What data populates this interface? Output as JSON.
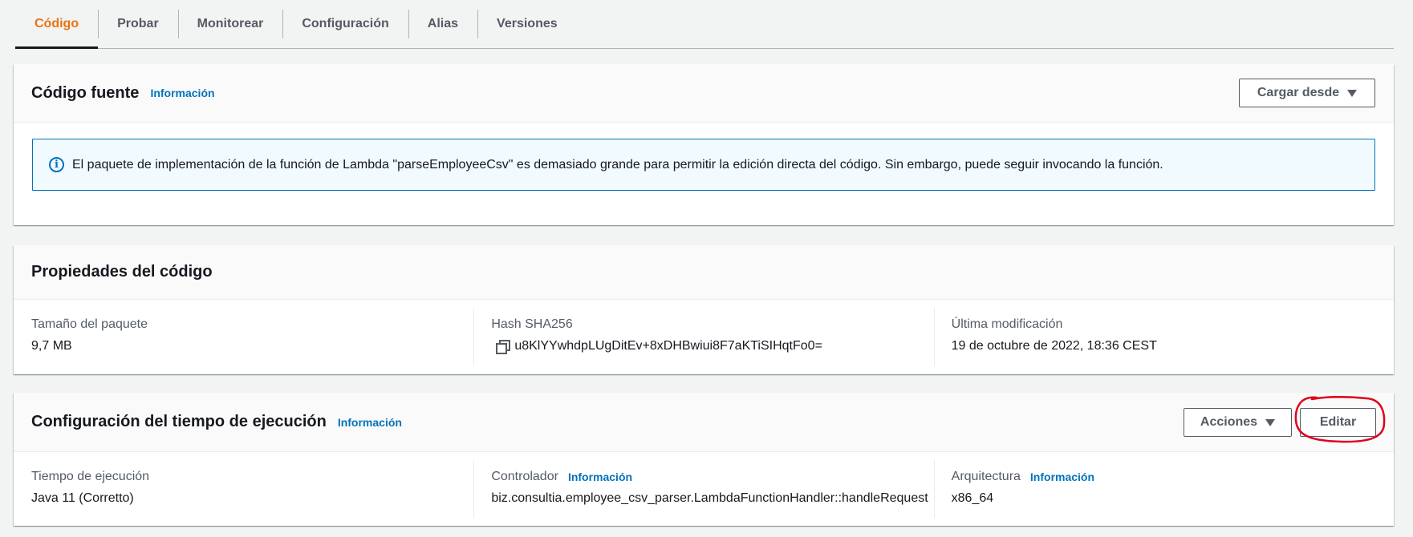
{
  "tabs": [
    "Código",
    "Probar",
    "Monitorear",
    "Configuración",
    "Alias",
    "Versiones"
  ],
  "source_panel": {
    "title": "Código fuente",
    "info": "Información",
    "upload_button": "Cargar desde",
    "alert_text": "El paquete de implementación de la función de Lambda \"parseEmployeeCsv\" es demasiado grande para permitir la edición directa del código. Sin embargo, puede seguir invocando la función."
  },
  "code_properties": {
    "title": "Propiedades del código",
    "package_size_label": "Tamaño del paquete",
    "package_size_value": "9,7 MB",
    "hash_label": "Hash SHA256",
    "hash_value": "u8KlYYwhdpLUgDitEv+8xDHBwiui8F7aKTiSIHqtFo0=",
    "modified_label": "Última modificación",
    "modified_value": "19 de octubre de 2022, 18:36 CEST"
  },
  "runtime_settings": {
    "title": "Configuración del tiempo de ejecución",
    "info": "Información",
    "actions_button": "Acciones",
    "edit_button": "Editar",
    "runtime_label": "Tiempo de ejecución",
    "runtime_value": "Java 11 (Corretto)",
    "handler_label": "Controlador",
    "handler_info": "Información",
    "handler_value": "biz.consultia.employee_csv_parser.LambdaFunctionHandler::handleRequest",
    "architecture_label": "Arquitectura",
    "architecture_info": "Información",
    "architecture_value": "x86_64"
  },
  "colors": {
    "accent": "#ec7211",
    "link": "#0073bb",
    "annotation": "#e0001b"
  }
}
